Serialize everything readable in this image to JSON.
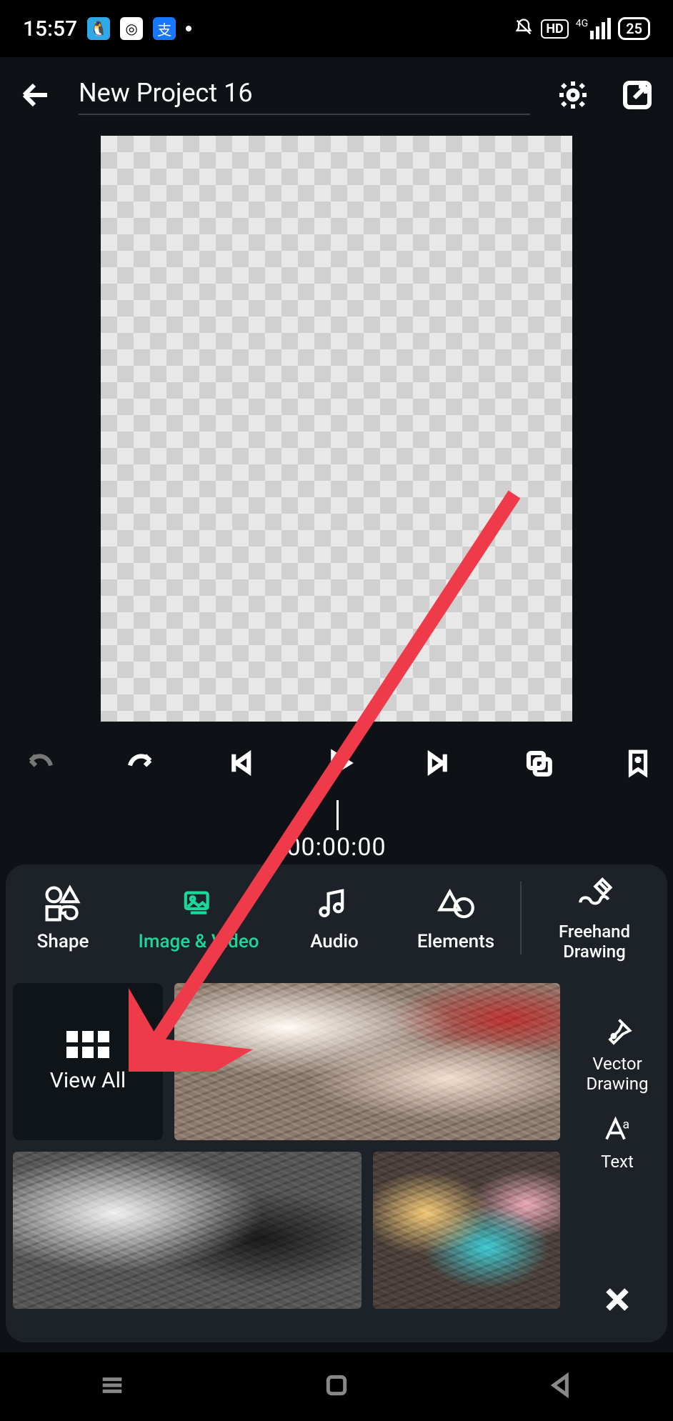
{
  "status": {
    "time": "15:57",
    "hd": "HD",
    "net": "4G",
    "battery": "25"
  },
  "header": {
    "title": "New Project 16"
  },
  "time": {
    "current": "00:00:00"
  },
  "tabs": {
    "shape": "Shape",
    "image_video": "Image & Video",
    "audio": "Audio",
    "elements": "Elements",
    "freehand": "Freehand\nDrawing"
  },
  "side": {
    "vector": "Vector\nDrawing",
    "text": "Text"
  },
  "view_all": "View All"
}
